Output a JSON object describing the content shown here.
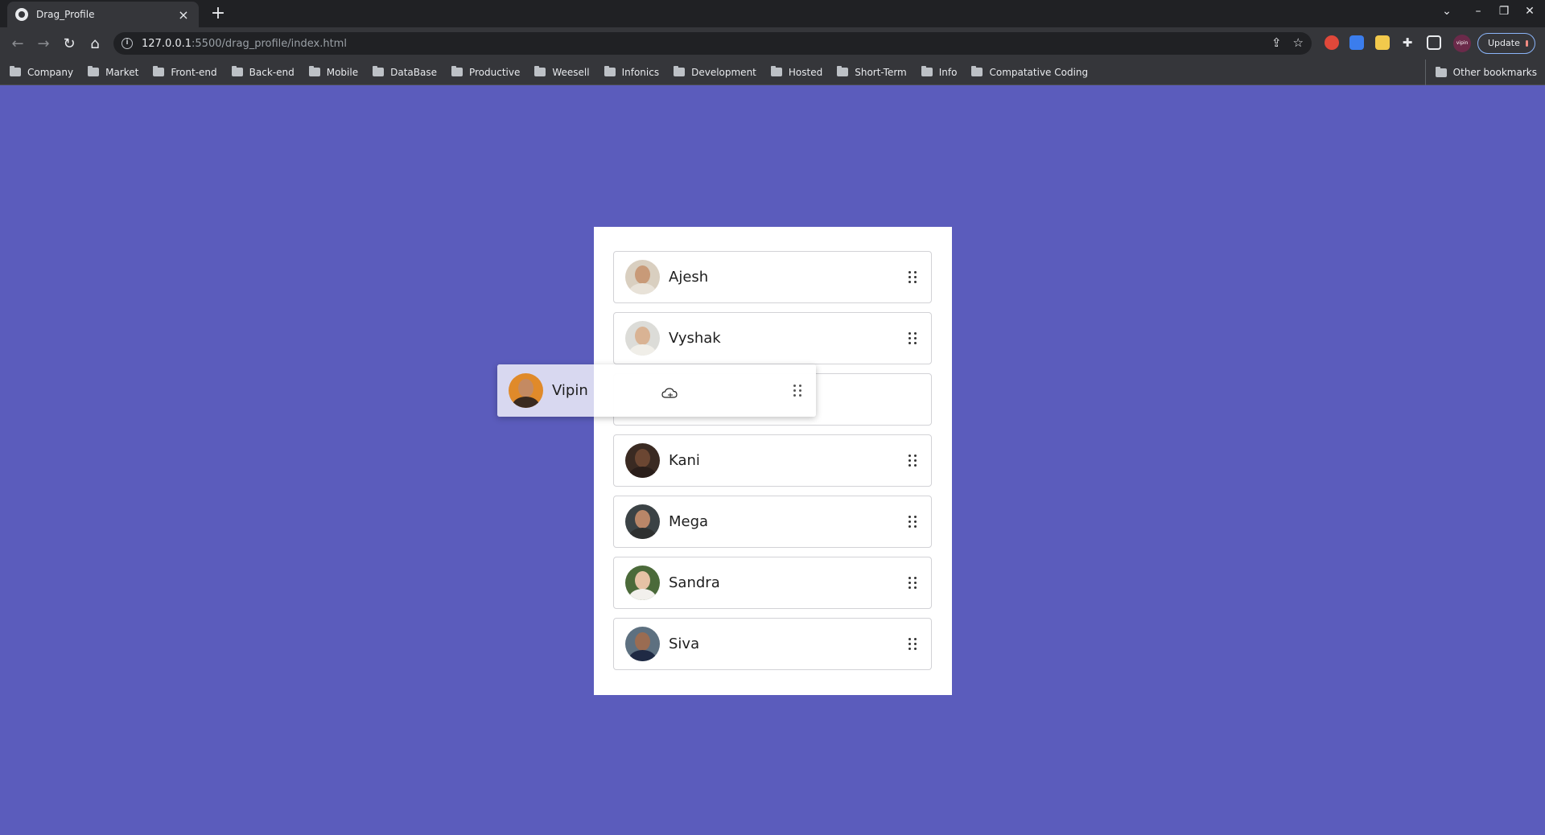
{
  "browser": {
    "tab_title": "Drag_Profile",
    "tab_close": "×",
    "new_tab": "+",
    "url_host": "127.0.0.1",
    "url_path": ":5500/drag_profile/index.html",
    "update_label": "Update",
    "profile_label": "vipin",
    "bookmarks": [
      "Company",
      "Market",
      "Front-end",
      "Back-end",
      "Mobile",
      "DataBase",
      "Productive",
      "Weesell",
      "Infonics",
      "Development",
      "Hosted",
      "Short-Term",
      "Info",
      "Compatative Coding"
    ],
    "other_bookmarks": "Other bookmarks"
  },
  "profiles": [
    {
      "name": "Ajesh",
      "skin": "#c89a78",
      "shirt": "#e8e2d8",
      "bg": "#d9cfc0"
    },
    {
      "name": "Vyshak",
      "skin": "#d9b394",
      "shirt": "#f0eee8",
      "bg": "#dcdcd8"
    },
    {
      "name": "",
      "skin": "",
      "shirt": "",
      "bg": ""
    },
    {
      "name": "Kani",
      "skin": "#6b4632",
      "shirt": "#2a1e1a",
      "bg": "#3a2a22"
    },
    {
      "name": "Mega",
      "skin": "#b98668",
      "shirt": "#2e3030",
      "bg": "#3b4245"
    },
    {
      "name": "Sandra",
      "skin": "#e6c2a5",
      "shirt": "#f2f0ec",
      "bg": "#4b6a3a"
    },
    {
      "name": "Siva",
      "skin": "#9a6c52",
      "shirt": "#1f2a44",
      "bg": "#5d7080"
    }
  ],
  "dragging": {
    "name": "Vipin",
    "skin": "#c48a62",
    "shirt": "#3a2a20",
    "bg": "#e08a2a"
  },
  "colors": {
    "page_bg": "#5b5cbc",
    "card_bg": "#ffffff"
  }
}
